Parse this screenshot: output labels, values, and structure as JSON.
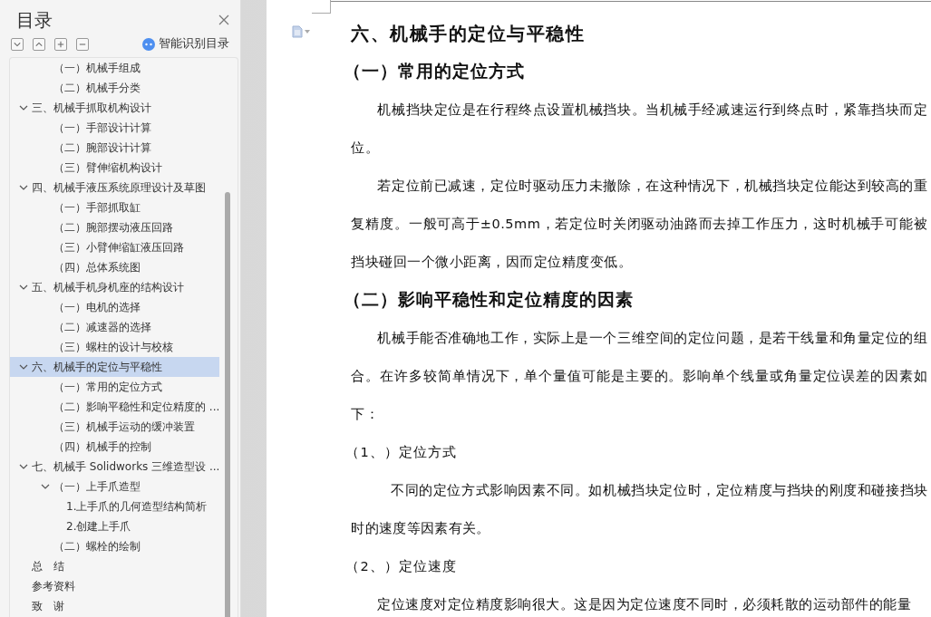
{
  "toc_panel": {
    "title": "目录",
    "smart_button": "智能识别目录",
    "outline": [
      {
        "kind": "continued",
        "children": [
          {
            "label": "（一）机械手组成",
            "selected": false
          },
          {
            "label": "（二）机械手分类",
            "selected": false
          }
        ]
      },
      {
        "label": "三、机械手抓取机构设计",
        "selected": false,
        "expanded": true,
        "children": [
          {
            "label": "（一）手部设计计算",
            "selected": false
          },
          {
            "label": "（二）腕部设计计算",
            "selected": false
          },
          {
            "label": "（三）臂伸缩机构设计",
            "selected": false
          }
        ]
      },
      {
        "label": "四、机械手液压系统原理设计及草图",
        "selected": false,
        "expanded": true,
        "children": [
          {
            "label": "（一）手部抓取缸",
            "selected": false
          },
          {
            "label": "（二）腕部摆动液压回路",
            "selected": false
          },
          {
            "label": "（三）小臂伸缩缸液压回路",
            "selected": false
          },
          {
            "label": "（四）总体系统图",
            "selected": false
          }
        ]
      },
      {
        "label": "五、机械手机身机座的结构设计",
        "selected": false,
        "expanded": true,
        "children": [
          {
            "label": "（一）电机的选择",
            "selected": false
          },
          {
            "label": "（二）减速器的选择",
            "selected": false
          },
          {
            "label": "（三）螺柱的设计与校核",
            "selected": false
          }
        ]
      },
      {
        "label": "六、机械手的定位与平稳性",
        "selected": true,
        "expanded": true,
        "children": [
          {
            "label": "（一）常用的定位方式",
            "selected": false
          },
          {
            "label": "（二）影响平稳性和定位精度的 ...",
            "selected": false
          },
          {
            "label": "（三）机械手运动的缓冲装置",
            "selected": false
          },
          {
            "label": "（四）机械手的控制",
            "selected": false
          }
        ]
      },
      {
        "label": "七、机械手 Solidworks 三维造型设 ...",
        "selected": false,
        "expanded": true,
        "children": [
          {
            "label": "（一）上手爪造型",
            "selected": false,
            "expanded": true,
            "children": [
              {
                "label": "1.上手爪的几何造型结构简析",
                "selected": false
              },
              {
                "label": "2.创建上手爪",
                "selected": false
              }
            ]
          },
          {
            "label": "（二）螺栓的绘制",
            "selected": false
          }
        ]
      },
      {
        "label": "总　结",
        "selected": false
      },
      {
        "label": "参考资料",
        "selected": false
      },
      {
        "label": "致　谢",
        "selected": false
      }
    ]
  },
  "document": {
    "blocks": [
      {
        "kind": "heading1",
        "text": "六、机械手的定位与平稳性"
      },
      {
        "kind": "heading2",
        "text": "（一）常用的定位方式"
      },
      {
        "kind": "paragraph",
        "text": "机械挡块定位是在行程终点设置机械挡块。当机械手经减速运行到终点时，紧靠挡块而定位。"
      },
      {
        "kind": "paragraph",
        "text": "若定位前已减速，定位时驱动压力未撤除，在这种情况下，机械挡块定位能达到较高的重复精度。一般可高于±0.5mm，若定位时关闭驱动油路而去掉工作压力，这时机械手可能被挡块碰回一个微小距离，因而定位精度变低。"
      },
      {
        "kind": "heading2",
        "text": "（二）影响平稳性和定位精度的因素"
      },
      {
        "kind": "paragraph",
        "text": "机械手能否准确地工作，实际上是一个三维空间的定位问题，是若干线量和角量定位的组合。在许多较简单情况下，单个量值可能是主要的。影响单个线量或角量定位误差的因素如下："
      },
      {
        "kind": "item",
        "text": "（1、）定位方式"
      },
      {
        "kind": "paragraph_deep",
        "text": "不同的定位方式影响因素不同。如机械挡块定位时，定位精度与挡块的刚度和碰接挡块时的速度等因素有关。"
      },
      {
        "kind": "item",
        "text": "（2、）定位速度"
      },
      {
        "kind": "paragraph",
        "text": "定位速度对定位精度影响很大。这是因为定位速度不同时，必须耗散的运动部件的能量"
      }
    ]
  }
}
